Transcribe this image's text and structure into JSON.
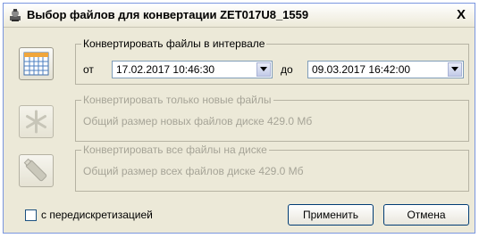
{
  "window": {
    "title": "Выбор файлов для конвертации ZET017U8_1559",
    "close_label": "X"
  },
  "interval": {
    "legend": "Конвертировать файлы в интервале",
    "from_label": "от",
    "from_value": "17.02.2017 10:46:30",
    "to_label": "до",
    "to_value": "09.03.2017 16:42:00"
  },
  "new_files": {
    "legend": "Конвертировать только новые файлы",
    "size_text": "Общий размер новых файлов диске   429.0 Мб"
  },
  "all_files": {
    "legend": "Конвертировать все файлы на диске",
    "size_text": "Общий размер всех файлов диске   429.0 Мб"
  },
  "resample_checkbox": {
    "label": "с передискретизацией",
    "checked": false
  },
  "buttons": {
    "apply": "Применить",
    "cancel": "Отмена"
  }
}
